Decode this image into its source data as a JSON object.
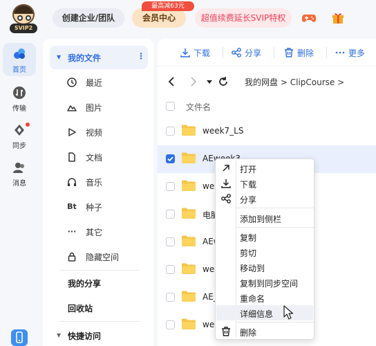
{
  "header": {
    "avatar_badge": "SVIP2",
    "team_button": "创建企业/团队",
    "vip_button": "会员中心",
    "vip_badge": "最高减63元",
    "svip_button": "超值续费延长SVIP特权",
    "icons": [
      "game-controller-icon",
      "gift-icon"
    ]
  },
  "rail": {
    "items": [
      {
        "label": "首页",
        "icon": "home-icon",
        "active": true
      },
      {
        "label": "传输",
        "icon": "transfer-icon"
      },
      {
        "label": "同步",
        "icon": "sync-icon",
        "badge_dot": true
      },
      {
        "label": "消息",
        "icon": "message-icon"
      }
    ],
    "bottom_icon": "phone-icon"
  },
  "sidebar": {
    "my_files": "我的文件",
    "items": [
      {
        "label": "最近",
        "icon": "clock-icon"
      },
      {
        "label": "图片",
        "icon": "image-icon"
      },
      {
        "label": "视频",
        "icon": "video-icon"
      },
      {
        "label": "文档",
        "icon": "document-icon"
      },
      {
        "label": "音乐",
        "icon": "headphones-icon"
      },
      {
        "label": "种子",
        "icon": "torrent-icon",
        "glyph": "Bt"
      },
      {
        "label": "其它",
        "icon": "more-icon",
        "glyph": "···"
      },
      {
        "label": "隐藏空间",
        "icon": "lock-icon"
      }
    ],
    "my_share": "我的分享",
    "recycle_bin": "回收站",
    "quick_access": "快捷访问"
  },
  "toolbar": {
    "download": "下载",
    "share": "分享",
    "delete": "删除",
    "more": "更多"
  },
  "breadcrumb": {
    "root": "我的网盘",
    "sep": ">",
    "current": "ClipCourse",
    "trail": ">"
  },
  "file_list": {
    "column_name": "文件名",
    "rows": [
      {
        "name": "week7_LS",
        "selected": false
      },
      {
        "name": "AEweek3",
        "selected": true
      },
      {
        "name": "we",
        "selected": false
      },
      {
        "name": "电脑",
        "selected": false
      },
      {
        "name": "AEw",
        "selected": false
      },
      {
        "name": "we",
        "selected": false
      },
      {
        "name": "AE_",
        "selected": false
      },
      {
        "name": "we",
        "selected": false
      }
    ]
  },
  "context_menu": {
    "items": [
      {
        "label": "打开",
        "icon": "open-arrow-icon"
      },
      {
        "label": "下载",
        "icon": "download-icon"
      },
      {
        "label": "分享",
        "icon": "share-icon"
      },
      {
        "label": "添加到侧栏"
      },
      {
        "label": "复制"
      },
      {
        "label": "剪切"
      },
      {
        "label": "移动到"
      },
      {
        "label": "复制到同步空间"
      },
      {
        "label": "重命名"
      },
      {
        "label": "详细信息",
        "hovered": true
      },
      {
        "label": "删除",
        "icon": "trash-icon"
      }
    ]
  },
  "colors": {
    "accent": "#2f6fe5",
    "folder": "#f7c54a",
    "selected_row": "#e9effc",
    "svip_text": "#e9415a"
  }
}
